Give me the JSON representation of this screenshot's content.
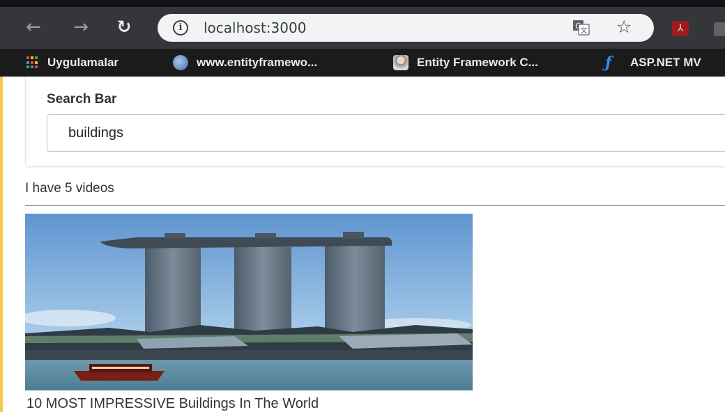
{
  "browser": {
    "url": "localhost:3000",
    "nav_icons": {
      "back": "back-arrow-icon",
      "forward": "forward-arrow-icon",
      "reload": "reload-icon"
    },
    "omnibox_icons": {
      "info": "info-icon",
      "translate": "translate-icon",
      "bookmark": "star-icon"
    },
    "extensions": [
      "pdf-extension-icon",
      "extension-icon"
    ],
    "bookmarks": [
      {
        "label": "Uygulamalar",
        "icon": "apps-grid-icon"
      },
      {
        "label": "www.entityframewo...",
        "icon": "entityframework-icon"
      },
      {
        "label": "Entity Framework C...",
        "icon": "person-avatar-icon"
      },
      {
        "label": "ASP.NET MV",
        "icon": "aspnet-icon"
      }
    ],
    "colors": {
      "toolbar": "#35363a",
      "bookmarks_bar": "#1b1b1c",
      "omnibox": "#f1f3f4"
    }
  },
  "search": {
    "label": "Search Bar",
    "value": "buildings"
  },
  "results": {
    "count_text": "I have 5 videos",
    "videos": [
      {
        "title": "10 MOST IMPRESSIVE Buildings In The World"
      }
    ]
  }
}
